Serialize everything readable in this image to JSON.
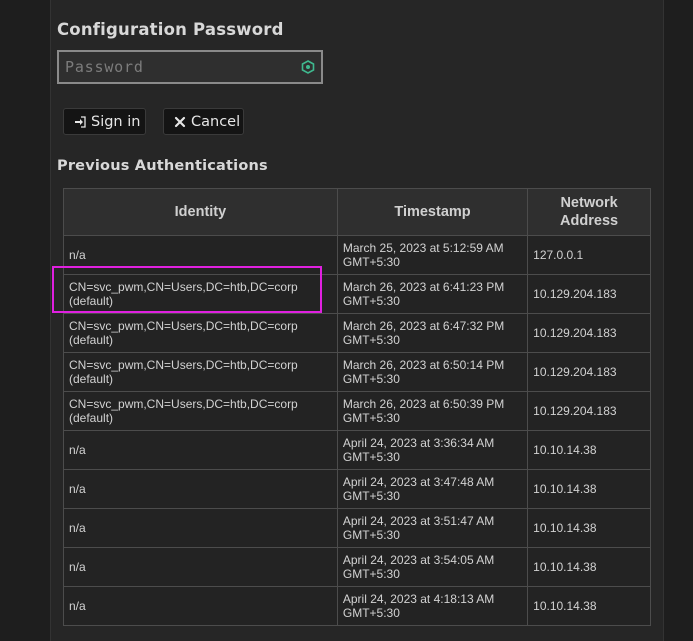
{
  "config_password": {
    "title": "Configuration Password",
    "password_placeholder": "Password"
  },
  "buttons": {
    "signin_label": "Sign in",
    "cancel_label": "Cancel"
  },
  "previous_authentications": {
    "title": "Previous Authentications",
    "columns": [
      "Identity",
      "Timestamp",
      "Network Address"
    ],
    "rows": [
      {
        "identity": "n/a",
        "timestamp": "March 25, 2023 at 5:12:59 AM GMT+5:30",
        "address": "127.0.0.1"
      },
      {
        "identity": "CN=svc_pwm,CN=Users,DC=htb,DC=corp (default)",
        "timestamp": "March 26, 2023 at 6:41:23 PM GMT+5:30",
        "address": "10.129.204.183"
      },
      {
        "identity": "CN=svc_pwm,CN=Users,DC=htb,DC=corp (default)",
        "timestamp": "March 26, 2023 at 6:47:32 PM GMT+5:30",
        "address": "10.129.204.183"
      },
      {
        "identity": "CN=svc_pwm,CN=Users,DC=htb,DC=corp (default)",
        "timestamp": "March 26, 2023 at 6:50:14 PM GMT+5:30",
        "address": "10.129.204.183"
      },
      {
        "identity": "CN=svc_pwm,CN=Users,DC=htb,DC=corp (default)",
        "timestamp": "March 26, 2023 at 6:50:39 PM GMT+5:30",
        "address": "10.129.204.183"
      },
      {
        "identity": "n/a",
        "timestamp": "April 24, 2023 at 3:36:34 AM GMT+5:30",
        "address": "10.10.14.38"
      },
      {
        "identity": "n/a",
        "timestamp": "April 24, 2023 at 3:47:48 AM GMT+5:30",
        "address": "10.10.14.38"
      },
      {
        "identity": "n/a",
        "timestamp": "April 24, 2023 at 3:51:47 AM GMT+5:30",
        "address": "10.10.14.38"
      },
      {
        "identity": "n/a",
        "timestamp": "April 24, 2023 at 3:54:05 AM GMT+5:30",
        "address": "10.10.14.38"
      },
      {
        "identity": "n/a",
        "timestamp": "April 24, 2023 at 4:18:13 AM GMT+5:30",
        "address": "10.10.14.38"
      }
    ]
  },
  "colors": {
    "highlight": "#e020e0",
    "password_icon": "#3fb98f"
  },
  "icons": {
    "password_field": "password-manager-icon",
    "signin": "sign-in-icon",
    "cancel": "close-icon"
  }
}
